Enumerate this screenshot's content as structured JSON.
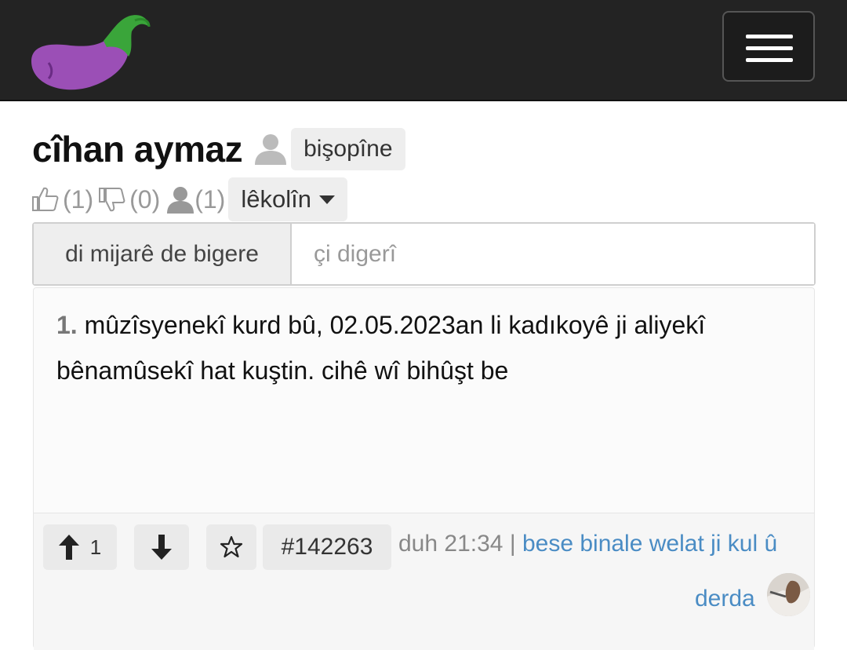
{
  "header": {
    "logo_icon": "eggplant-logo",
    "menu_icon": "hamburger-menu-icon"
  },
  "topic": {
    "title": "cîhan aymaz",
    "follow_label": "bişopîne",
    "likes": "(1)",
    "dislikes": "(0)",
    "followers": "(1)",
    "explore_label": "lêkolîn"
  },
  "search": {
    "addon_label": "di mijarê de bigere",
    "placeholder": "çi digerî"
  },
  "entry": {
    "number": "1.",
    "text": "mûzîsyenekî kurd bû, 02.05.2023an li kadıkoyê ji aliyekî bênamûsekî hat kuştin. cihê wî bihûşt be",
    "upvotes": "1",
    "id": "#142263",
    "time": "duh 21:34",
    "separator": "|",
    "author_line1": "bese binale welat ji kul û",
    "author_line2": "derda"
  },
  "colors": {
    "header_bg": "#232323",
    "link": "#4a8cc4",
    "logo_purple": "#9b4fb6",
    "logo_green": "#3aa53a"
  }
}
